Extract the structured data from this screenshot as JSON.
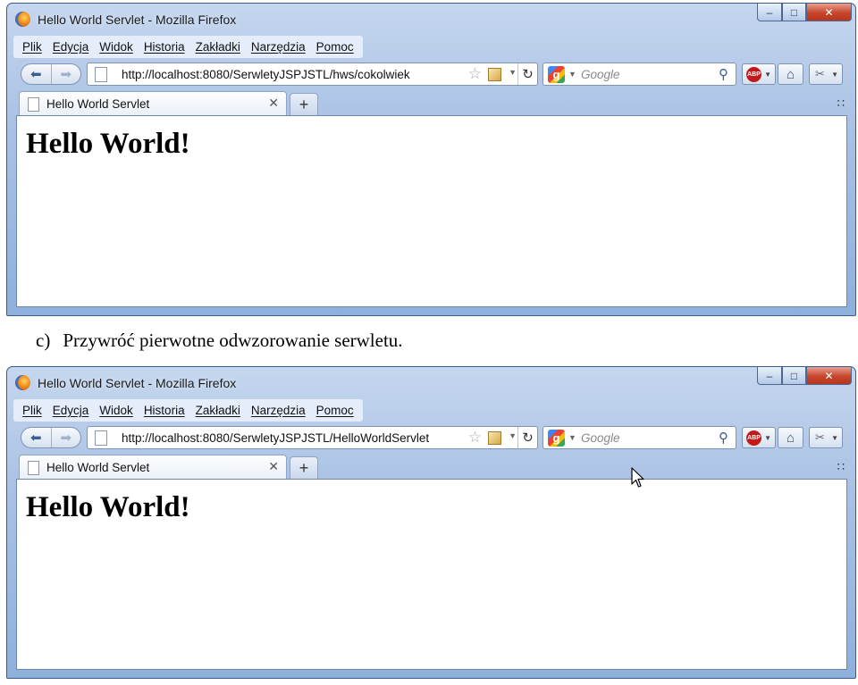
{
  "windows": [
    {
      "window_title": "Hello World Servlet - Mozilla Firefox",
      "menu": [
        "Plik",
        "Edycja",
        "Widok",
        "Historia",
        "Zakładki",
        "Narzędzia",
        "Pomoc"
      ],
      "url": "http://localhost:8080/SerwletyJSPJSTL/hws/cokolwiek",
      "search_placeholder": "Google",
      "tab_title": "Hello World Servlet",
      "page_heading": "Hello World!"
    },
    {
      "window_title": "Hello World Servlet - Mozilla Firefox",
      "menu": [
        "Plik",
        "Edycja",
        "Widok",
        "Historia",
        "Zakładki",
        "Narzędzia",
        "Pomoc"
      ],
      "url": "http://localhost:8080/SerwletyJSPJSTL/HelloWorldServlet",
      "search_placeholder": "Google",
      "tab_title": "Hello World Servlet",
      "page_heading": "Hello World!"
    }
  ],
  "caption": {
    "number": "c)",
    "text": "Przywróć pierwotne odwzorowanie serwletu."
  },
  "icons": {
    "app": "firefox-icon",
    "back": "back-arrow-icon",
    "forward": "forward-arrow-icon",
    "reload": "reload-icon",
    "bookmark": "star-icon",
    "feed": "rss-icon",
    "search": "magnifier-icon",
    "home": "home-icon",
    "addon": "adblock-icon",
    "tab_close": "close-icon",
    "new_tab": "plus-icon",
    "cursor": "mouse-cursor-icon"
  },
  "colors": {
    "window_frame": "#8fb0dc",
    "close_button": "#c8452c",
    "adblock": "#c21a1a"
  }
}
